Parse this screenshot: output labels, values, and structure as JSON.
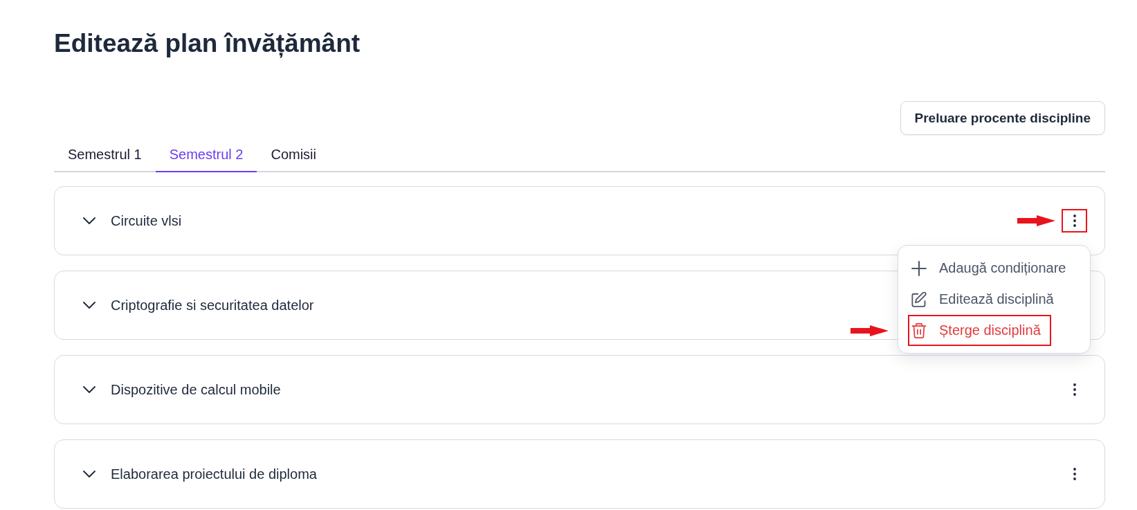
{
  "page_title": "Editează plan învățământ",
  "action_button": {
    "label": "Preluare procente discipline"
  },
  "tabs": [
    {
      "label": "Semestrul 1",
      "selected": false
    },
    {
      "label": "Semestrul 2",
      "selected": true
    },
    {
      "label": "Comisii",
      "selected": false
    }
  ],
  "disciplines": [
    {
      "name": "Circuite vlsi",
      "expanded": false,
      "menu_open": true,
      "highlighted": true
    },
    {
      "name": "Criptografie si securitatea datelor",
      "expanded": false,
      "menu_open": false,
      "highlighted": false
    },
    {
      "name": "Dispozitive de calcul mobile",
      "expanded": false,
      "menu_open": false,
      "highlighted": false
    },
    {
      "name": "Elaborarea proiectului de diploma",
      "expanded": false,
      "menu_open": false,
      "highlighted": false
    }
  ],
  "context_menu": {
    "items": [
      {
        "kind": "add",
        "label": "Adaugă condiționare",
        "highlighted": false
      },
      {
        "kind": "edit",
        "label": "Editează disciplină",
        "highlighted": false
      },
      {
        "kind": "delete",
        "label": "Șterge disciplină",
        "highlighted": true
      }
    ]
  }
}
